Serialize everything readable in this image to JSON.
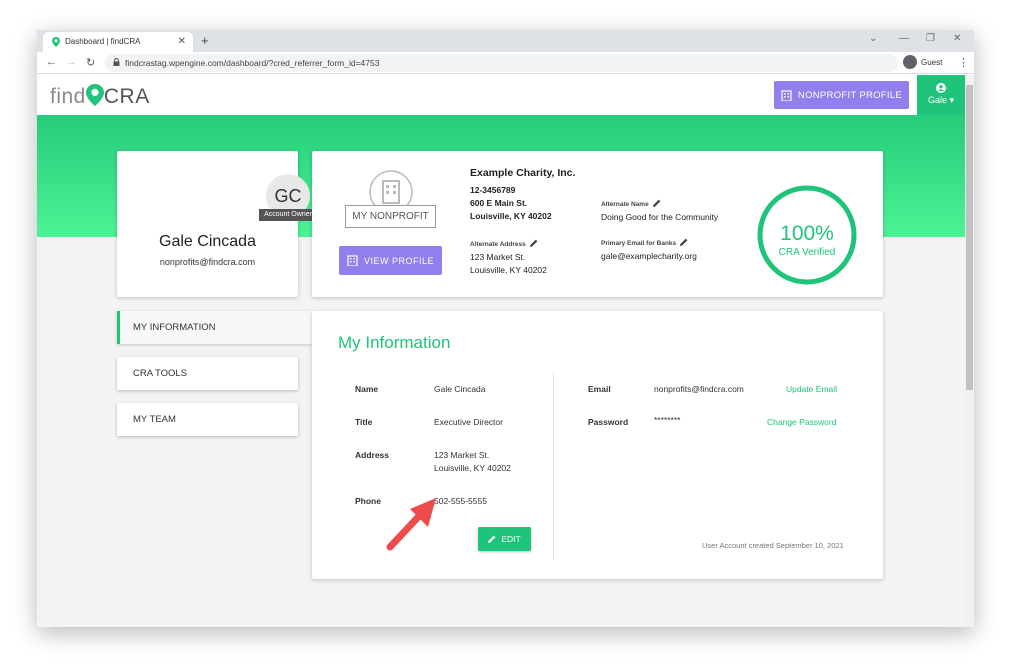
{
  "browser": {
    "tab_title": "Dashboard | findCRA",
    "url": "findcrastag.wpengine.com/dashboard/?cred_referrer_form_id=4753",
    "profile_label": "Guest"
  },
  "header": {
    "logo_find": "find",
    "logo_cra": "CRA",
    "nonprofit_profile_label": "NONPROFIT PROFILE",
    "user_label": "Gale"
  },
  "profile_card": {
    "initials": "GC",
    "role_badge": "Account Owner",
    "name": "Gale Cincada",
    "email": "nonprofits@findcra.com"
  },
  "nonprofit_card": {
    "logo_label": "MY NONPROFIT",
    "view_profile_label": "VIEW PROFILE",
    "org_name": "Example Charity, Inc.",
    "ein": "12-3456789",
    "address_line1": "600 E Main St.",
    "address_line2": "Louisville, KY 40202",
    "alt_address_label": "Alternate Address",
    "alt_address_line1": "123 Market St.",
    "alt_address_line2": "Louisville, KY 40202",
    "alt_name_label": "Alternate Name",
    "alt_name": "Doing Good for the Community",
    "primary_email_label": "Primary Email for Banks",
    "primary_email": "gale@examplecharity.org",
    "verified_percent_text": "100%",
    "verified_percent": 100,
    "verified_label": "CRA Verified"
  },
  "sidebar": {
    "items": [
      {
        "label": "MY INFORMATION",
        "active": true
      },
      {
        "label": "CRA TOOLS",
        "active": false
      },
      {
        "label": "MY TEAM",
        "active": false
      }
    ]
  },
  "my_info": {
    "title": "My Information",
    "name_label": "Name",
    "name_value": "Gale Cincada",
    "title_label": "Title",
    "title_value": "Executive Director",
    "address_label": "Address",
    "address_line1": "123 Market St.",
    "address_line2": "Louisville, KY 40202",
    "phone_label": "Phone",
    "phone_value": "502-555-5555",
    "edit_label": "EDIT",
    "email_label": "Email",
    "email_value": "nonprofits@findcra.com",
    "update_email_label": "Update Email",
    "password_label": "Password",
    "password_value": "********",
    "change_password_label": "Change Password",
    "created_text": "User Account created September 10, 2021"
  },
  "colors": {
    "brand_green": "#1ec479",
    "button_purple": "#8f80ee",
    "annotation_arrow": "#ee4b4b"
  },
  "icons": [
    "lock-icon",
    "building-icon",
    "pencil-icon",
    "user-circle-icon",
    "caret-down-icon",
    "annotation-arrow"
  ]
}
